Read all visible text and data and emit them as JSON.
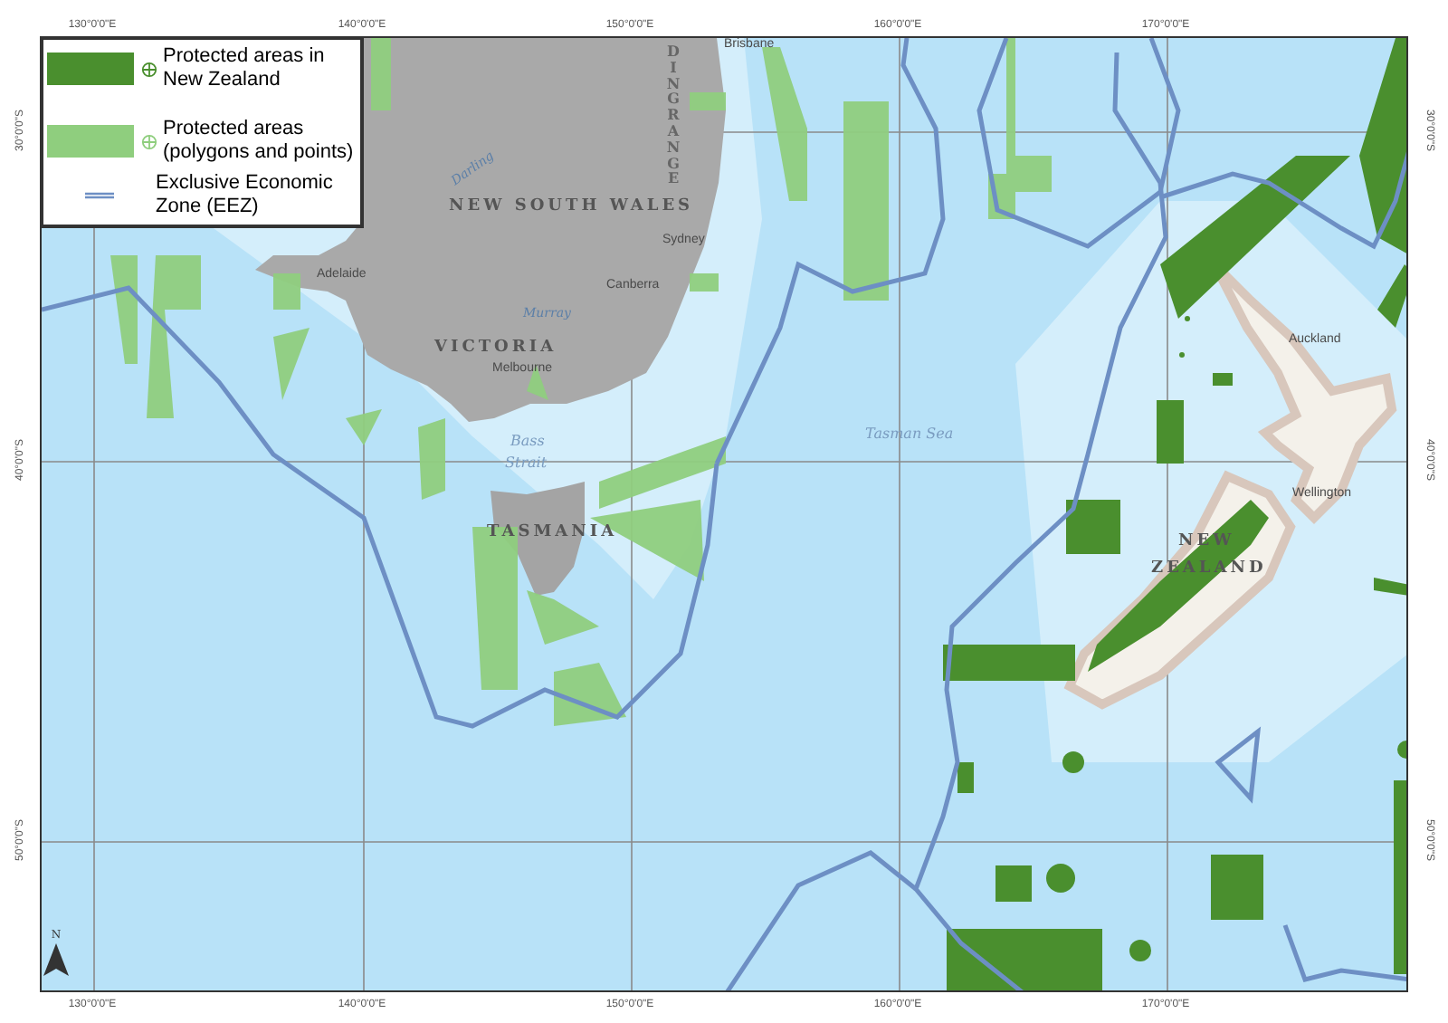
{
  "legend": [
    {
      "kind": "patch",
      "color": "#4a8f2e",
      "label": "Protected areas in New Zealand"
    },
    {
      "kind": "patch",
      "color": "#8fce7e",
      "label": "Protected areas (polygons and points)"
    },
    {
      "kind": "line",
      "color": "#6d8fc4",
      "label": "Exclusive Economic Zone (EEZ)"
    }
  ],
  "graticule": {
    "top": [
      "130°0'0\"E",
      "140°0'0\"E",
      "150°0'0\"E",
      "160°0'0\"E",
      "170°0'0\"E"
    ],
    "bottom": [
      "130°0'0\"E",
      "140°0'0\"E",
      "150°0'0\"E",
      "160°0'0\"E",
      "170°0'0\"E"
    ],
    "left": [
      "30°0'0\"S",
      "40°0'0\"S",
      "50°0'0\"S"
    ],
    "right": [
      "30°0'0\"S",
      "40°0'0\"S",
      "50°0'0\"S"
    ]
  },
  "places": [
    {
      "kind": "city",
      "text": "Brisbane"
    },
    {
      "kind": "range",
      "text": "DINGRANGE"
    },
    {
      "kind": "river",
      "text": "Darling"
    },
    {
      "kind": "region",
      "text": "NEW SOUTH WALES"
    },
    {
      "kind": "city",
      "text": "Sydney"
    },
    {
      "kind": "city",
      "text": "Canberra"
    },
    {
      "kind": "river",
      "text": "Murray"
    },
    {
      "kind": "city",
      "text": "Adelaide"
    },
    {
      "kind": "region",
      "text": "VICTORIA"
    },
    {
      "kind": "city",
      "text": "Melbourne"
    },
    {
      "kind": "water",
      "text": "Bass"
    },
    {
      "kind": "water",
      "text": "Strait"
    },
    {
      "kind": "region",
      "text": "TASMANIA"
    },
    {
      "kind": "water",
      "text": "Tasman Sea"
    },
    {
      "kind": "city",
      "text": "Auckland"
    },
    {
      "kind": "city",
      "text": "Wellington"
    },
    {
      "kind": "region",
      "text": "NEW"
    },
    {
      "kind": "region",
      "text": "ZEALAND"
    }
  ],
  "north_arrow": {
    "label": "N"
  }
}
